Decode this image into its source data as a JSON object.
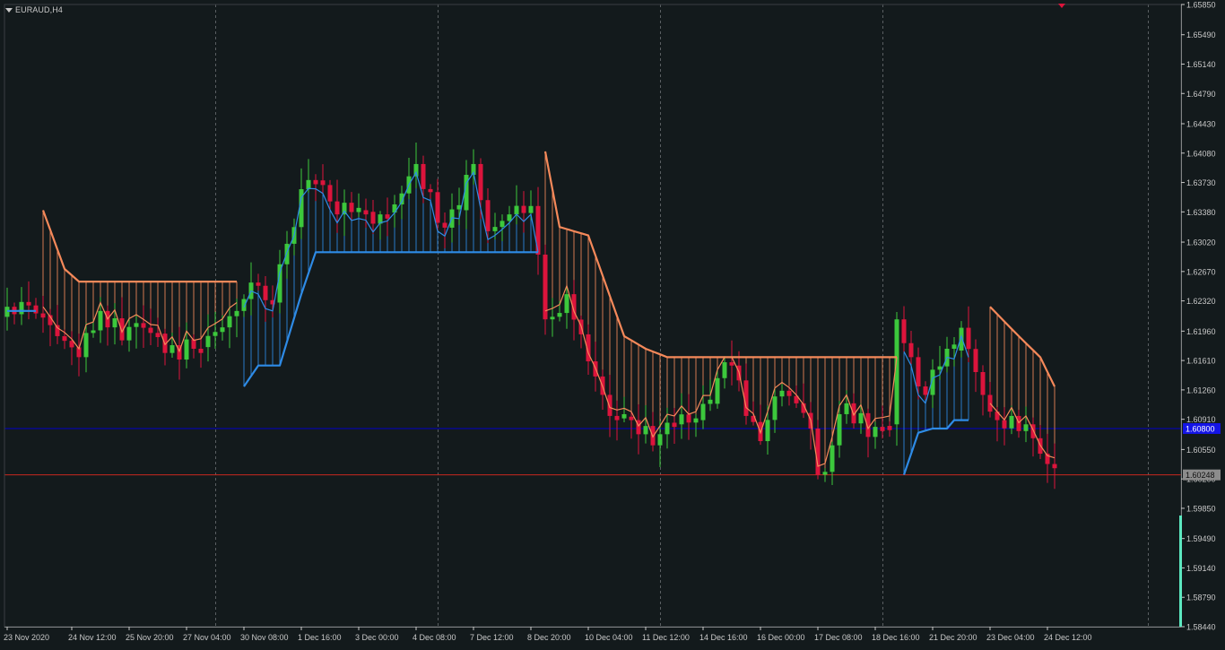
{
  "window": {
    "title": "EURAUD,H4"
  },
  "colors": {
    "background": "#131a1c",
    "axis": "#c8c8c8",
    "grid": "#5a5f62",
    "bull_candle": "#3cc83c",
    "bear_candle": "#dc143c",
    "upper_band": "#f5895a",
    "lower_band": "#2e8be6",
    "bid_line": "#0000c8",
    "ask_line": "#c8281e",
    "bid_label_bg": "#1414e6",
    "ask_label_bg": "#8c8c8c",
    "volume_bar": "#5ce8c0"
  },
  "price_labels": {
    "bid": "1.60800",
    "ask": "1.60248"
  },
  "chart_data": {
    "type": "candlestick",
    "symbol": "EURAUD",
    "timeframe": "H4",
    "ylim": [
      1.5844,
      1.6585
    ],
    "y_ticks": [
      "1.65850",
      "1.65490",
      "1.65140",
      "1.64790",
      "1.64430",
      "1.64080",
      "1.63730",
      "1.63380",
      "1.63020",
      "1.62670",
      "1.62320",
      "1.61960",
      "1.61610",
      "1.61260",
      "1.60910",
      "1.60550",
      "1.60200",
      "1.59850",
      "1.59490",
      "1.59140",
      "1.58790",
      "1.58440"
    ],
    "x_ticks": [
      {
        "i": 0,
        "label": "23 Nov 2020"
      },
      {
        "i": 9,
        "label": "24 Nov 12:00"
      },
      {
        "i": 17,
        "label": "25 Nov 20:00"
      },
      {
        "i": 25,
        "label": "27 Nov 04:00"
      },
      {
        "i": 33,
        "label": "30 Nov 08:00"
      },
      {
        "i": 41,
        "label": "1 Dec 16:00"
      },
      {
        "i": 49,
        "label": "3 Dec 00:00"
      },
      {
        "i": 57,
        "label": "4 Dec 08:00"
      },
      {
        "i": 65,
        "label": "7 Dec 12:00"
      },
      {
        "i": 73,
        "label": "8 Dec 20:00"
      },
      {
        "i": 81,
        "label": "10 Dec 04:00"
      },
      {
        "i": 89,
        "label": "11 Dec 12:00"
      },
      {
        "i": 97,
        "label": "14 Dec 16:00"
      },
      {
        "i": 105,
        "label": "16 Dec 00:00"
      },
      {
        "i": 113,
        "label": "17 Dec 08:00"
      },
      {
        "i": 121,
        "label": "18 Dec 16:00"
      },
      {
        "i": 129,
        "label": "21 Dec 20:00"
      },
      {
        "i": 137,
        "label": "23 Dec 04:00"
      },
      {
        "i": 145,
        "label": "24 Dec 12:00"
      }
    ],
    "key_closes": [
      {
        "i": 0,
        "c": 1.6225
      },
      {
        "i": 5,
        "c": 1.6215
      },
      {
        "i": 7,
        "c": 1.619
      },
      {
        "i": 10,
        "c": 1.6165
      },
      {
        "i": 13,
        "c": 1.622
      },
      {
        "i": 16,
        "c": 1.6185
      },
      {
        "i": 19,
        "c": 1.62
      },
      {
        "i": 22,
        "c": 1.617
      },
      {
        "i": 26,
        "c": 1.6175
      },
      {
        "i": 29,
        "c": 1.6195
      },
      {
        "i": 32,
        "c": 1.622
      },
      {
        "i": 35,
        "c": 1.625
      },
      {
        "i": 37,
        "c": 1.623
      },
      {
        "i": 39,
        "c": 1.63
      },
      {
        "i": 41,
        "c": 1.6365
      },
      {
        "i": 44,
        "c": 1.637
      },
      {
        "i": 46,
        "c": 1.6335
      },
      {
        "i": 49,
        "c": 1.634
      },
      {
        "i": 52,
        "c": 1.6335
      },
      {
        "i": 55,
        "c": 1.636
      },
      {
        "i": 57,
        "c": 1.6395
      },
      {
        "i": 60,
        "c": 1.6325
      },
      {
        "i": 63,
        "c": 1.634
      },
      {
        "i": 65,
        "c": 1.6395
      },
      {
        "i": 67,
        "c": 1.6315
      },
      {
        "i": 70,
        "c": 1.6335
      },
      {
        "i": 73,
        "c": 1.6345
      },
      {
        "i": 75,
        "c": 1.621
      },
      {
        "i": 78,
        "c": 1.624
      },
      {
        "i": 81,
        "c": 1.616
      },
      {
        "i": 84,
        "c": 1.6095
      },
      {
        "i": 87,
        "c": 1.609
      },
      {
        "i": 90,
        "c": 1.606
      },
      {
        "i": 93,
        "c": 1.6085
      },
      {
        "i": 96,
        "c": 1.609
      },
      {
        "i": 99,
        "c": 1.614
      },
      {
        "i": 101,
        "c": 1.6155
      },
      {
        "i": 103,
        "c": 1.6095
      },
      {
        "i": 105,
        "c": 1.6065
      },
      {
        "i": 108,
        "c": 1.6125
      },
      {
        "i": 110,
        "c": 1.611
      },
      {
        "i": 112,
        "c": 1.608
      },
      {
        "i": 113,
        "c": 1.6025
      },
      {
        "i": 115,
        "c": 1.606
      },
      {
        "i": 117,
        "c": 1.611
      },
      {
        "i": 120,
        "c": 1.607
      },
      {
        "i": 123,
        "c": 1.6085
      },
      {
        "i": 124,
        "c": 1.621
      },
      {
        "i": 126,
        "c": 1.6165
      },
      {
        "i": 128,
        "c": 1.612
      },
      {
        "i": 131,
        "c": 1.6175
      },
      {
        "i": 133,
        "c": 1.62
      },
      {
        "i": 136,
        "c": 1.612
      },
      {
        "i": 138,
        "c": 1.609
      },
      {
        "i": 140,
        "c": 1.6095
      },
      {
        "i": 142,
        "c": 1.6085
      },
      {
        "i": 144,
        "c": 1.605
      },
      {
        "i": 146,
        "c": 1.6035
      }
    ],
    "upper_band_segments": [
      {
        "start": 5,
        "end": 32,
        "anchors": [
          [
            5,
            1.634
          ],
          [
            8,
            1.627
          ],
          [
            10,
            1.6255
          ],
          [
            32,
            1.6255
          ]
        ]
      },
      {
        "start": 75,
        "end": 124,
        "anchors": [
          [
            75,
            1.641
          ],
          [
            77,
            1.632
          ],
          [
            81,
            1.631
          ],
          [
            86,
            1.619
          ],
          [
            89,
            1.6175
          ],
          [
            92,
            1.6165
          ],
          [
            124,
            1.6165
          ]
        ]
      },
      {
        "start": 137,
        "end": 146,
        "anchors": [
          [
            137,
            1.6225
          ],
          [
            141,
            1.619
          ],
          [
            144,
            1.6165
          ],
          [
            146,
            1.613
          ]
        ]
      }
    ],
    "lower_band_segments": [
      {
        "start": 0,
        "end": 4,
        "anchors": [
          [
            0,
            1.622
          ],
          [
            4,
            1.622
          ]
        ]
      },
      {
        "start": 33,
        "end": 74,
        "anchors": [
          [
            33,
            1.613
          ],
          [
            35,
            1.6155
          ],
          [
            38,
            1.6155
          ],
          [
            41,
            1.624
          ],
          [
            43,
            1.629
          ],
          [
            74,
            1.629
          ]
        ]
      },
      {
        "start": 125,
        "end": 134,
        "anchors": [
          [
            125,
            1.6025
          ],
          [
            127,
            1.6075
          ],
          [
            129,
            1.608
          ],
          [
            131,
            1.608
          ],
          [
            132,
            1.609
          ],
          [
            134,
            1.609
          ]
        ]
      }
    ]
  }
}
